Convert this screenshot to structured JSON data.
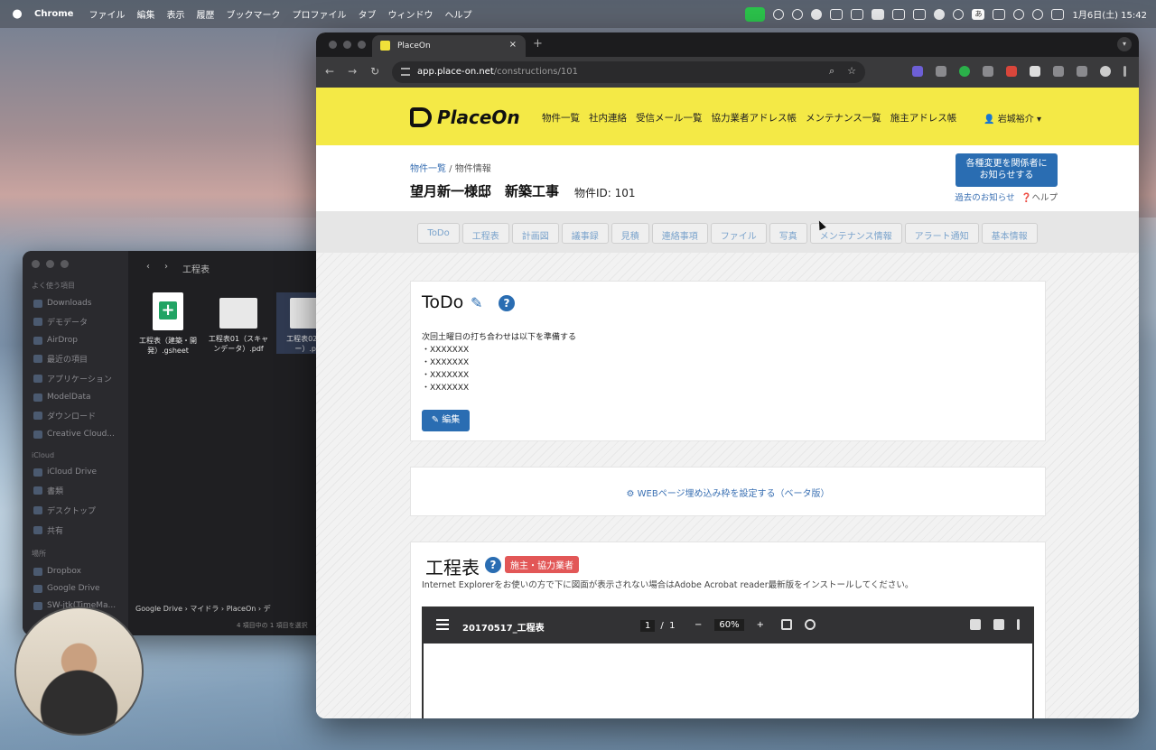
{
  "menubar": {
    "app": "Chrome",
    "items": [
      "ファイル",
      "編集",
      "表示",
      "履歴",
      "ブックマーク",
      "プロファイル",
      "タブ",
      "ウィンドウ",
      "ヘルプ"
    ],
    "clock": "1月6日(土) 15:42",
    "ime": "あ"
  },
  "finder": {
    "title": "工程表",
    "sidebar": {
      "favorites_header": "よく使う項目",
      "favorites": [
        "Downloads",
        "デモデータ",
        "AirDrop",
        "最近の項目",
        "アプリケーション",
        "ModelData",
        "ダウンロード",
        "Creative Cloud..."
      ],
      "icloud_header": "iCloud",
      "icloud": [
        "iCloud Drive",
        "書類",
        "デスクトップ",
        "共有"
      ],
      "places_header": "場所",
      "places": [
        "Dropbox",
        "Google Drive",
        "SW-jtk(TimeMa..."
      ]
    },
    "files": [
      {
        "name": "工程表（建築・開発）.gsheet"
      },
      {
        "name": "工程表01（スキャンデータ）.pdf"
      },
      {
        "name": "工程表02（...ー）.p..."
      }
    ],
    "path": [
      "Google Drive",
      "マイドラ",
      "PlaceOn",
      "デ"
    ],
    "count": "4 項目中の 1 項目を選択"
  },
  "browser": {
    "tab_title": "PlaceOn",
    "url_host": "app.place-on.net",
    "url_path": "/constructions/101"
  },
  "site": {
    "logo": "PlaceOn",
    "nav": [
      "物件一覧",
      "社内連絡",
      "受信メール一覧",
      "協力業者アドレス帳",
      "メンテナンス一覧",
      "施主アドレス帳"
    ],
    "user": "岩城裕介",
    "breadcrumb": {
      "link": "物件一覧",
      "sep": " / ",
      "current": "物件情報"
    },
    "title": "望月新一様邸　新築工事",
    "project_id": "物件ID: 101",
    "notify_button": [
      "各種変更を関係者に",
      "お知らせする"
    ],
    "past_notice": "過去のお知らせ",
    "help": "ヘルプ",
    "tabs": [
      "ToDo",
      "工程表",
      "計画図",
      "議事録",
      "見積",
      "連絡事項",
      "ファイル",
      "写真",
      "メンテナンス情報",
      "アラート通知",
      "基本情報"
    ]
  },
  "todo": {
    "title": "ToDo",
    "lines": [
      "次回土曜日の打ち合わせは以下を準備する",
      "・XXXXXXX",
      "・XXXXXXX",
      "・XXXXXXX",
      "・XXXXXXX"
    ],
    "edit_button": "編集"
  },
  "embed": {
    "link": "WEBページ埋め込み枠を設定する（ベータ版）"
  },
  "schedule": {
    "title": "工程表",
    "badge": "施主・協力業者",
    "note": "Internet Explorerをお使いの方で下に図面が表示されない場合はAdobe Acrobat reader最新版をインストールしてください。",
    "pdf": {
      "name": "20170517_工程表",
      "page": "1",
      "sep": "/",
      "pages": "1",
      "zoom": "60%"
    }
  },
  "colors": {
    "header_bg": "#f4e946",
    "primary": "#2a6db2",
    "badge": "#e25757"
  }
}
